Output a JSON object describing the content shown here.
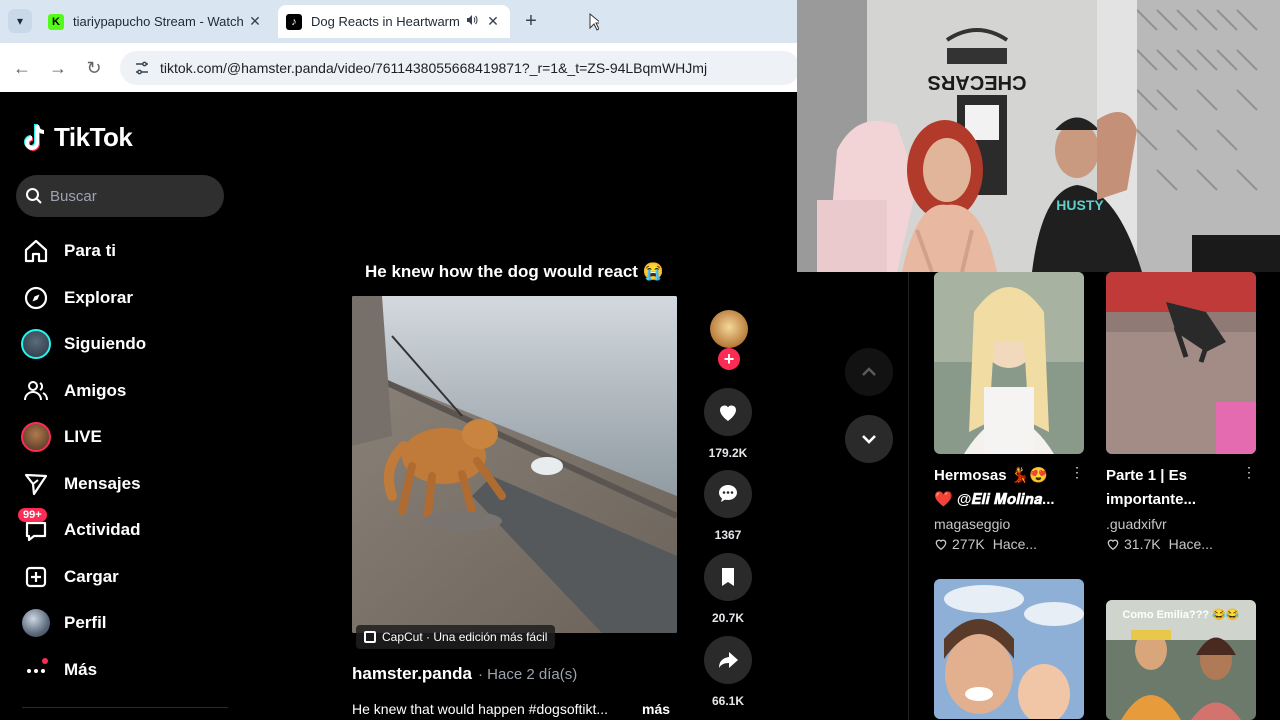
{
  "browser": {
    "tabs": [
      {
        "title": "tiariypapucho Stream - Watch Live",
        "favicon": "kick-icon",
        "active": false
      },
      {
        "title": "Dog Reacts in Heartwarming Way",
        "favicon": "tiktok-icon",
        "active": true
      }
    ],
    "new_tab_symbol": "+",
    "close_symbol": "✕",
    "url": "tiktok.com/@hamster.panda/video/7611438055668419871?_r=1&_t=ZS-94LBqmWHJmj"
  },
  "tiktok": {
    "logo_text": "TikTok",
    "search_placeholder": "Buscar",
    "nav": [
      {
        "label": "Para ti",
        "icon": "home-icon"
      },
      {
        "label": "Explorar",
        "icon": "compass-icon"
      },
      {
        "label": "Siguiendo",
        "icon": "following-avatar"
      },
      {
        "label": "Amigos",
        "icon": "friends-icon"
      },
      {
        "label": "LIVE",
        "icon": "live-avatar"
      },
      {
        "label": "Mensajes",
        "icon": "send-icon"
      },
      {
        "label": "Actividad",
        "icon": "activity-icon",
        "badge": "99+"
      },
      {
        "label": "Cargar",
        "icon": "upload-icon"
      },
      {
        "label": "Perfil",
        "icon": "profile-avatar"
      },
      {
        "label": "Más",
        "icon": "more-icon"
      }
    ],
    "video": {
      "caption_top": "He knew how the dog would react 😭",
      "capcut_label": "CapCut · Una edición más fácil",
      "author": "hamster.panda",
      "posted": "· Hace 2 día(s)",
      "description": "He knew that would happen #dogsoftikt...",
      "more_label": "más",
      "likes": "179.2K",
      "comments": "1367",
      "saves": "20.7K",
      "shares": "66.1K"
    },
    "related": [
      {
        "title": "Hermosas 💃😍❤️ @𝑬𝒍𝒊 𝑴𝒐𝒍𝒊𝒏𝒂...",
        "user": "magaseggio",
        "likes": "277K",
        "time": "Hace..."
      },
      {
        "title": "Parte 1 | Es importante...",
        "user": ".guadxifvr",
        "likes": "31.7K",
        "time": "Hace..."
      },
      {
        "overlay_text": ""
      },
      {
        "overlay_text": "Como Emilia??? 😂😂"
      }
    ]
  },
  "webcam": {
    "sign_text": "CHECARS"
  },
  "colors": {
    "accent": "#fe2c55",
    "cyan": "#25f4ee",
    "background": "#000000"
  }
}
